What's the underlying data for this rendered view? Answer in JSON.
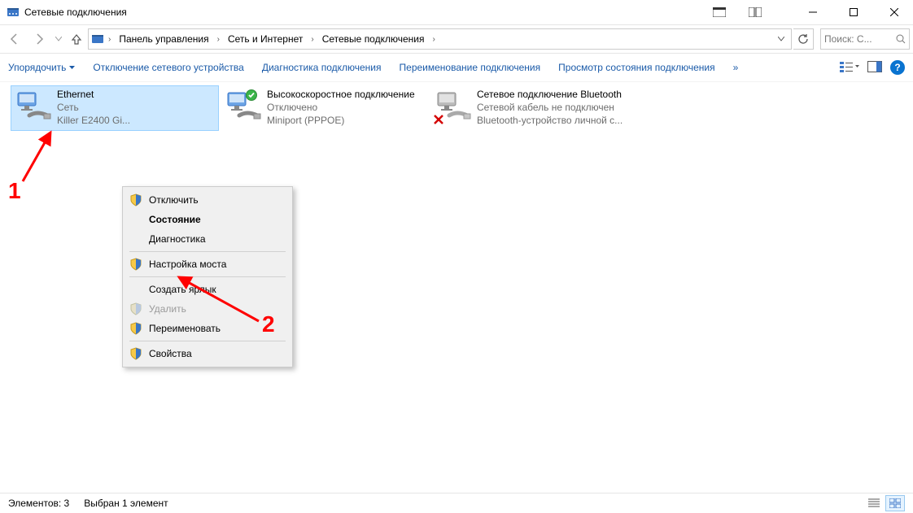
{
  "window": {
    "title": "Сетевые подключения"
  },
  "breadcrumb": {
    "root_icon": "control-panel",
    "items": [
      "Панель управления",
      "Сеть и Интернет",
      "Сетевые подключения"
    ]
  },
  "search": {
    "placeholder": "Поиск: С..."
  },
  "cmdbar": {
    "organize": "Упорядочить",
    "disable": "Отключение сетевого устройства",
    "diagnose": "Диагностика подключения",
    "rename": "Переименование подключения",
    "status": "Просмотр состояния подключения",
    "more": "»"
  },
  "connections": [
    {
      "id": "ethernet",
      "title": "Ethernet",
      "status": "Сеть",
      "device": "Killer E2400 Gi...",
      "selected": true,
      "overlay": "none"
    },
    {
      "id": "pppoe",
      "title": "Высокоскоростное подключение",
      "status": "Отключено",
      "device": "Miniport (PPPOE)",
      "selected": false,
      "overlay": "ok"
    },
    {
      "id": "bluetooth",
      "title": "Сетевое подключение Bluetooth",
      "status": "Сетевой кабель не подключен",
      "device": "Bluetooth-устройство личной с...",
      "selected": false,
      "overlay": "x"
    }
  ],
  "context_menu": {
    "disconnect": "Отключить",
    "state": "Состояние",
    "diag": "Диагностика",
    "bridge": "Настройка моста",
    "shortcut": "Создать ярлык",
    "delete": "Удалить",
    "rename": "Переименовать",
    "props": "Свойства"
  },
  "annotations": {
    "one": "1",
    "two": "2"
  },
  "statusbar": {
    "count": "Элементов: 3",
    "selected": "Выбран 1 элемент"
  }
}
